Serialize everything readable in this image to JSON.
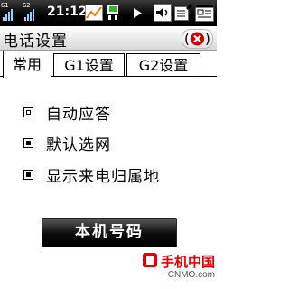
{
  "status_bar": {
    "signal_1_label": "G1",
    "signal_2_label": "G2",
    "time": "21:12"
  },
  "window": {
    "title": "电话设置",
    "close_icon": "close-circle-x-icon"
  },
  "tabs": [
    {
      "label": "常用",
      "active": true
    },
    {
      "label": "G1设置",
      "active": false
    },
    {
      "label": "G2设置",
      "active": false
    }
  ],
  "options": [
    {
      "label": "自动应答",
      "checked": false
    },
    {
      "label": "默认选网",
      "checked": true
    },
    {
      "label": "显示来电归属地",
      "checked": true
    }
  ],
  "phone_number_button": "本机号码",
  "watermark": {
    "name": "手机中国",
    "domain": "CNMO.com"
  },
  "colors": {
    "close_icon_red": "#cc0000",
    "watermark_red": "#e00000",
    "status_bar_bg": "#000000"
  }
}
